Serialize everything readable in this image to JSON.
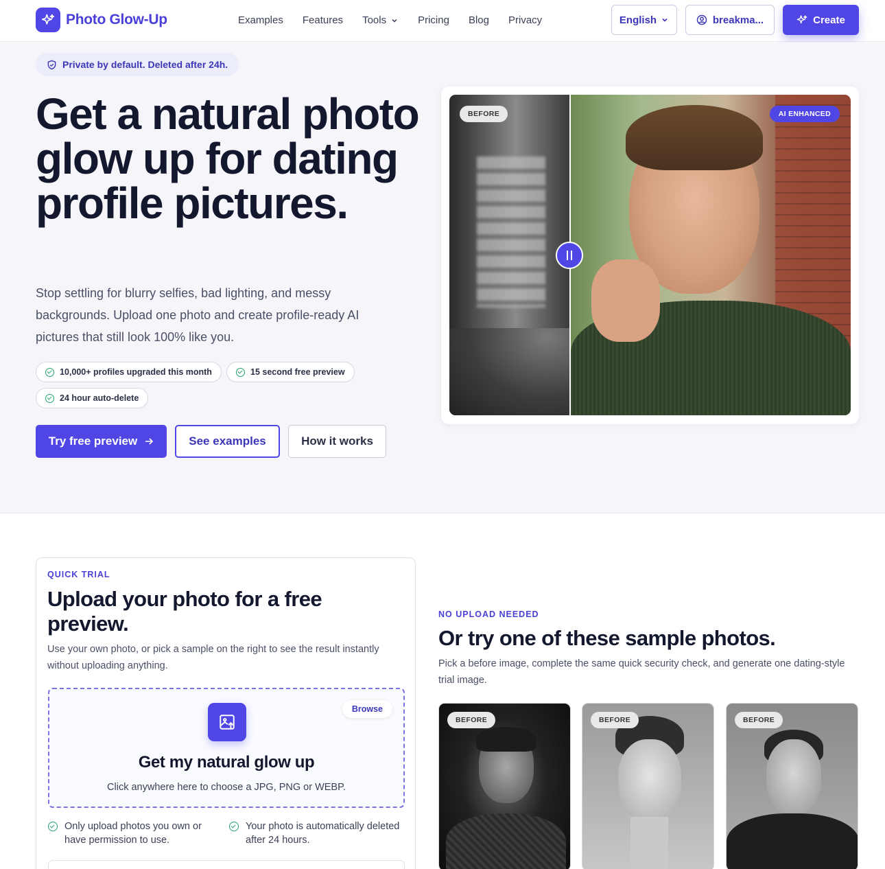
{
  "header": {
    "brand": "Photo Glow-Up",
    "nav": [
      "Examples",
      "Features",
      "Tools",
      "Pricing",
      "Blog",
      "Privacy"
    ],
    "language": "English",
    "user": "breakma...",
    "create": "Create"
  },
  "hero": {
    "privacy_badge": "Private by default. Deleted after 24h.",
    "title": "Get a natural photo glow up for dating profile pictures.",
    "subtitle": "Stop settling for blurry selfies, bad lighting, and messy backgrounds. Upload one photo and create profile-ready AI pictures that still look 100% like you.",
    "pills": [
      "10,000+ profiles upgraded this month",
      "15 second free preview",
      "24 hour auto-delete"
    ],
    "btn_try": "Try free preview",
    "btn_examples": "See examples",
    "btn_how": "How it works",
    "compare": {
      "before_label": "BEFORE",
      "after_label": "AI ENHANCED"
    }
  },
  "trial": {
    "eyebrow": "QUICK TRIAL",
    "title": "Upload your photo for a free preview.",
    "desc": "Use your own photo, or pick a sample on the right to see the result instantly without uploading anything.",
    "browse": "Browse",
    "dz_title": "Get my natural glow up",
    "dz_sub": "Click anywhere here to choose a JPG, PNG or WEBP.",
    "note1": "Only upload photos you own or have permission to use.",
    "note2": "Your photo is automatically deleted after 24 hours."
  },
  "samples": {
    "eyebrow": "NO UPLOAD NEEDED",
    "title": "Or try one of these sample photos.",
    "desc": "Pick a before image, complete the same quick security check, and generate one dating-style trial image.",
    "cards": [
      {
        "label": "BEFORE"
      },
      {
        "label": "BEFORE"
      },
      {
        "label": "BEFORE"
      }
    ]
  },
  "colors": {
    "accent": "#5046e5",
    "success": "#22a56b",
    "hero_bg": "#f5f5fa"
  }
}
